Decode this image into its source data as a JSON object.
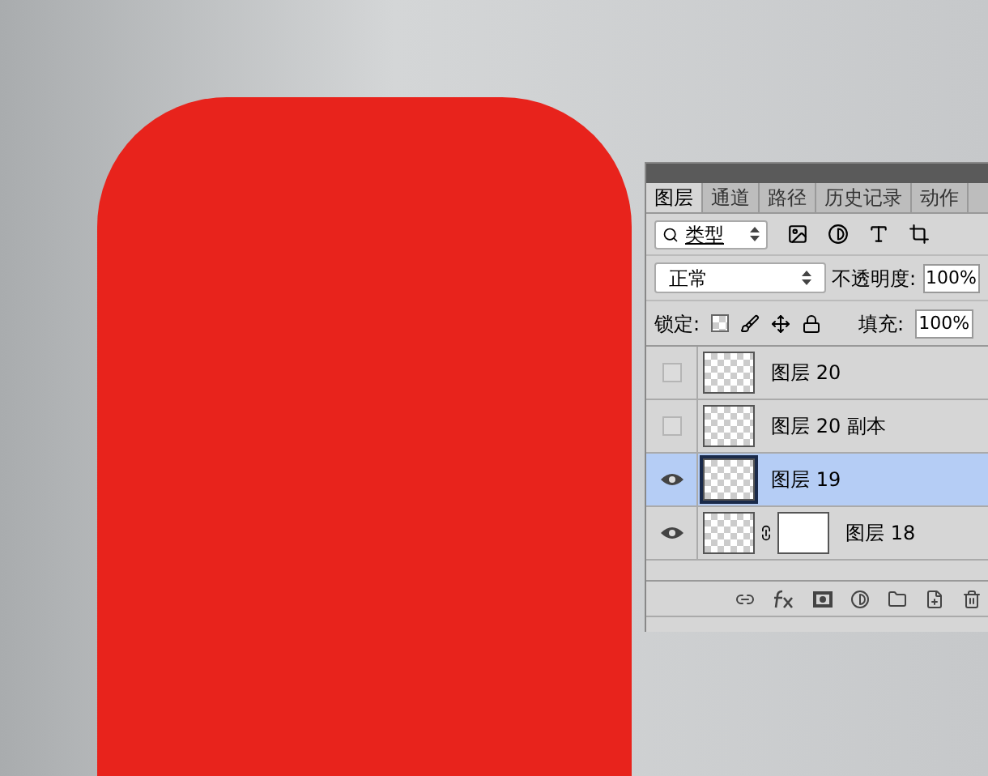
{
  "panel": {
    "tabs": [
      {
        "label": "图层",
        "selected": true
      },
      {
        "label": "通道",
        "selected": false
      },
      {
        "label": "路径",
        "selected": false
      },
      {
        "label": "历史记录",
        "selected": false
      },
      {
        "label": "动作",
        "selected": false
      }
    ],
    "filter": {
      "value": "类型"
    },
    "blend_mode": {
      "value": "正常"
    },
    "opacity": {
      "label": "不透明度:",
      "value": "100%"
    },
    "lock": {
      "label": "锁定:"
    },
    "fill": {
      "label": "填充:",
      "value": "100%"
    },
    "layers": [
      {
        "name": "图层 20",
        "visible": false,
        "selected": false,
        "mask": false
      },
      {
        "name": "图层 20 副本",
        "visible": false,
        "selected": false,
        "mask": false
      },
      {
        "name": "图层 19",
        "visible": true,
        "selected": true,
        "mask": false
      },
      {
        "name": "图层 18",
        "visible": true,
        "selected": false,
        "mask": true
      }
    ]
  }
}
